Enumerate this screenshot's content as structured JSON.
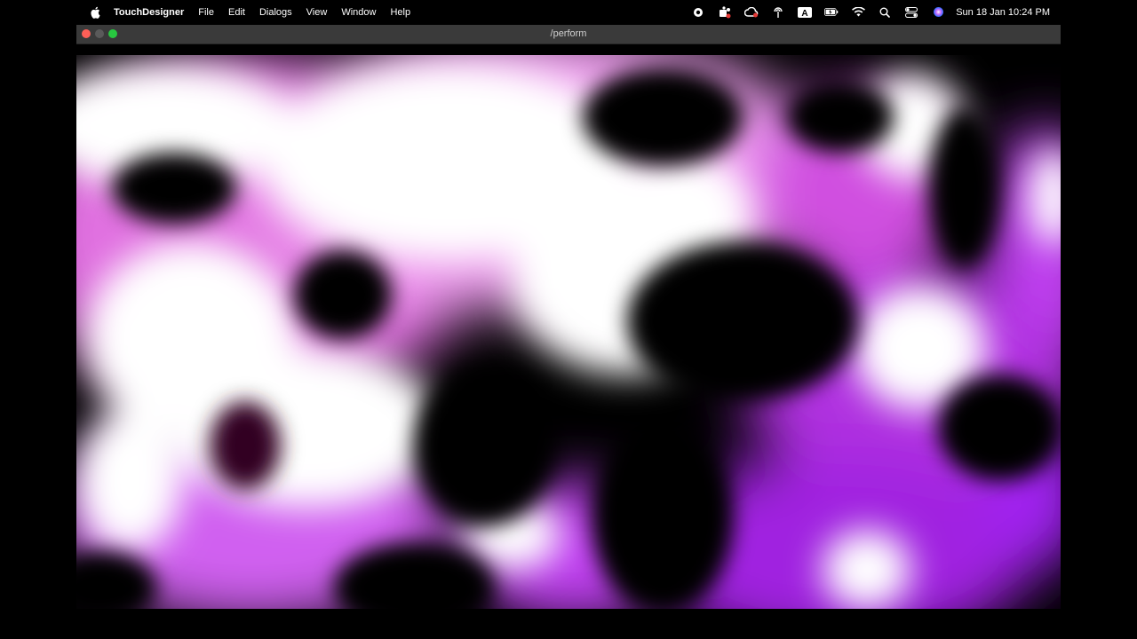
{
  "menubar": {
    "app_name": "TouchDesigner",
    "items": [
      "File",
      "Edit",
      "Dialogs",
      "View",
      "Window",
      "Help"
    ],
    "status_icons": [
      "screen-record-icon",
      "teams-icon",
      "creative-cloud-icon",
      "airdrop-icon",
      "input-source-icon",
      "battery-icon",
      "wifi-icon",
      "spotlight-search-icon",
      "control-center-icon",
      "siri-icon"
    ],
    "input_source_letter": "A",
    "clock": "Sun 18 Jan  10:24 PM"
  },
  "window": {
    "title": "/perform"
  },
  "canvas": {
    "description_colors": {
      "background": "#000000",
      "highlight": "#ffffff",
      "accent_pink": "#ff66ee",
      "accent_purple": "#a020f0"
    }
  }
}
